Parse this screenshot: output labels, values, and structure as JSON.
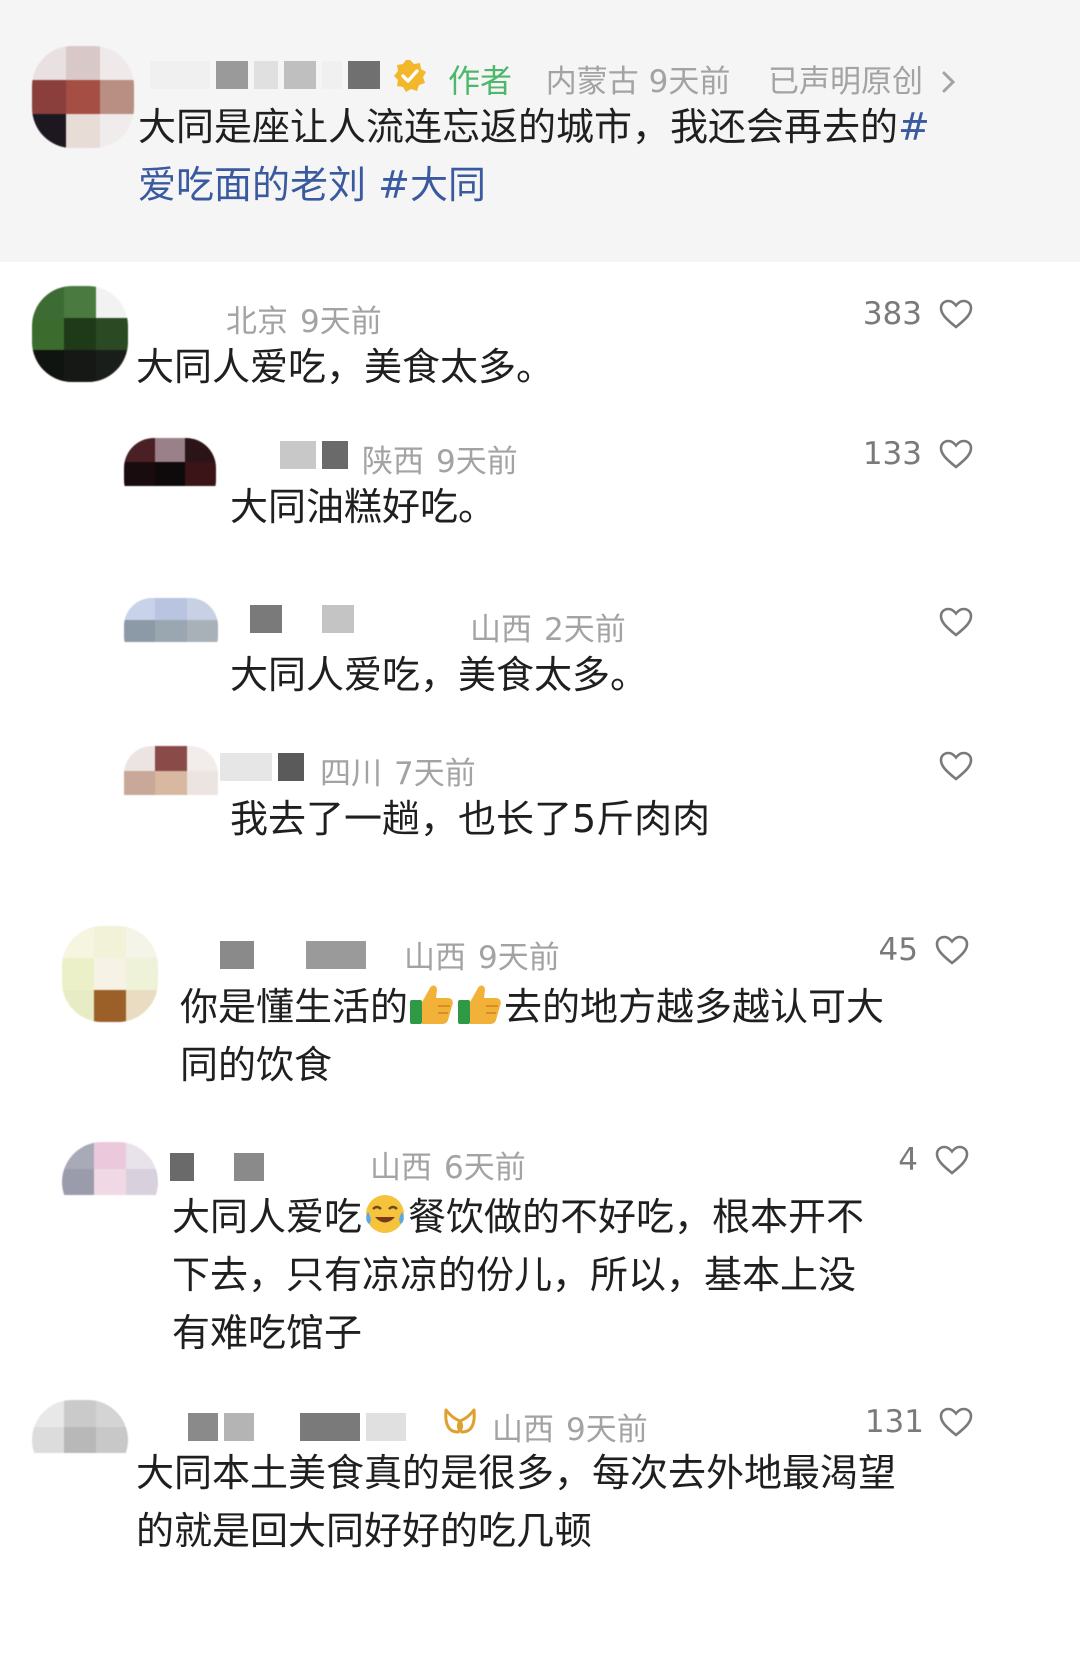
{
  "author_comment": {
    "author_tag": "作者",
    "location": "内蒙古",
    "time": "9天前",
    "original_label": "已声明原创",
    "text": "大同是座让人流连忘返的城市，我还会再去的",
    "hashtag1_line1": "#",
    "hashtag1_line2": "爱吃面的老刘",
    "hashtag2": "#大同"
  },
  "comments": [
    {
      "location": "北京",
      "time": "9天前",
      "likes": "383",
      "text": "大同人爱吃，美食太多。"
    },
    {
      "location": "陕西",
      "time": "9天前",
      "likes": "133",
      "text": "大同油糕好吃。"
    },
    {
      "location": "山西",
      "time": "2天前",
      "likes": "",
      "text": "大同人爱吃，美食太多。"
    },
    {
      "location": "四川",
      "time": "7天前",
      "likes": "",
      "text": "我去了一趟，也长了5斤肉肉"
    },
    {
      "location": "山西",
      "time": "9天前",
      "likes": "45",
      "text_part1": "你是懂生活的",
      "text_part2": "去的地方越多越认可大",
      "text_line2": "同的饮食"
    },
    {
      "location": "山西",
      "time": "6天前",
      "likes": "4",
      "text_part1": "大同人爱吃",
      "text_part2": "餐饮做的不好吃，根本开不",
      "text_line2": "下去，只有凉凉的份儿，所以，基本上没",
      "text_line3": "有难吃馆子"
    },
    {
      "location": "山西",
      "time": "9天前",
      "likes": "131",
      "text_line1": "大同本土美食真的是很多，每次去外地最渴望",
      "text_line2": "的就是回大同好好的吃几顿"
    }
  ],
  "icons": {
    "heart": "heart-outline-icon",
    "verified": "verified-badge-icon",
    "chevron": "chevron-right-icon",
    "thumbs_up": "thumbs-up-emoji",
    "crying": "crying-laughing-emoji",
    "fans_badge": "fans-badge-icon"
  },
  "colors": {
    "author_green": "#4db86a",
    "hashtag_blue": "#3a5aa0",
    "meta_gray": "#a3a3a3"
  }
}
